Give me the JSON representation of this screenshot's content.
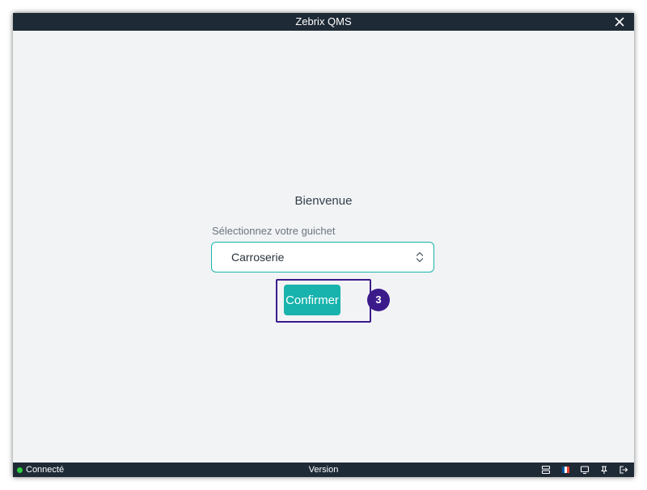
{
  "window": {
    "title": "Zebrix QMS"
  },
  "main": {
    "welcome": "Bienvenue",
    "select_label": "Sélectionnez votre guichet",
    "select_value": "Carroserie",
    "confirm_label": "Confirmer",
    "step_badge": "3"
  },
  "statusbar": {
    "connection_status": "Connecté",
    "version_label": "Version",
    "icons": [
      "server-icon",
      "flag-fr-icon",
      "screen-icon",
      "pin-icon",
      "logout-icon"
    ]
  },
  "colors": {
    "titlebar_bg": "#1f2a37",
    "accent": "#17b3ac",
    "highlight": "#3b1a8a",
    "status_connected": "#2ecc40",
    "flag_blue": "#0055a4",
    "flag_white": "#ffffff",
    "flag_red": "#ef4135"
  }
}
